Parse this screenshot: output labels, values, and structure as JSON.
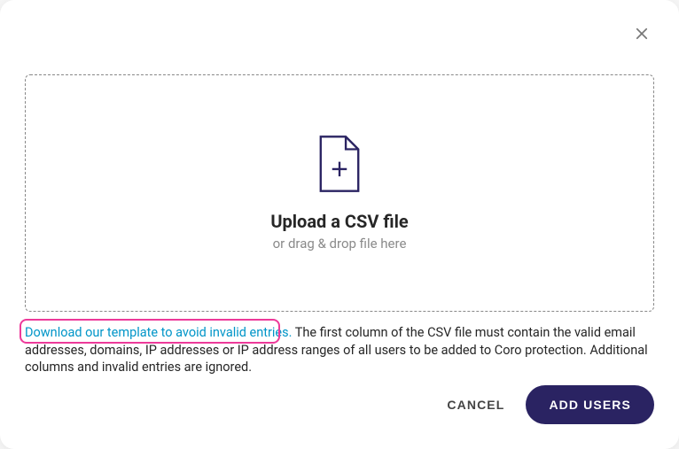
{
  "dropzone": {
    "title": "Upload a CSV file",
    "subtitle": "or drag & drop file here"
  },
  "help": {
    "templateLink": "Download our template to avoid invalid entries.",
    "rest": " The first column of the CSV file must contain the valid email addresses, domains, IP addresses or IP address ranges of all users to be added to Coro protection. Additional columns and invalid entries are ignored."
  },
  "actions": {
    "cancel": "CANCEL",
    "addUsers": "ADD USERS"
  },
  "colors": {
    "primary": "#2a2362",
    "link": "#0095c8",
    "highlight": "#ed3a9a"
  }
}
